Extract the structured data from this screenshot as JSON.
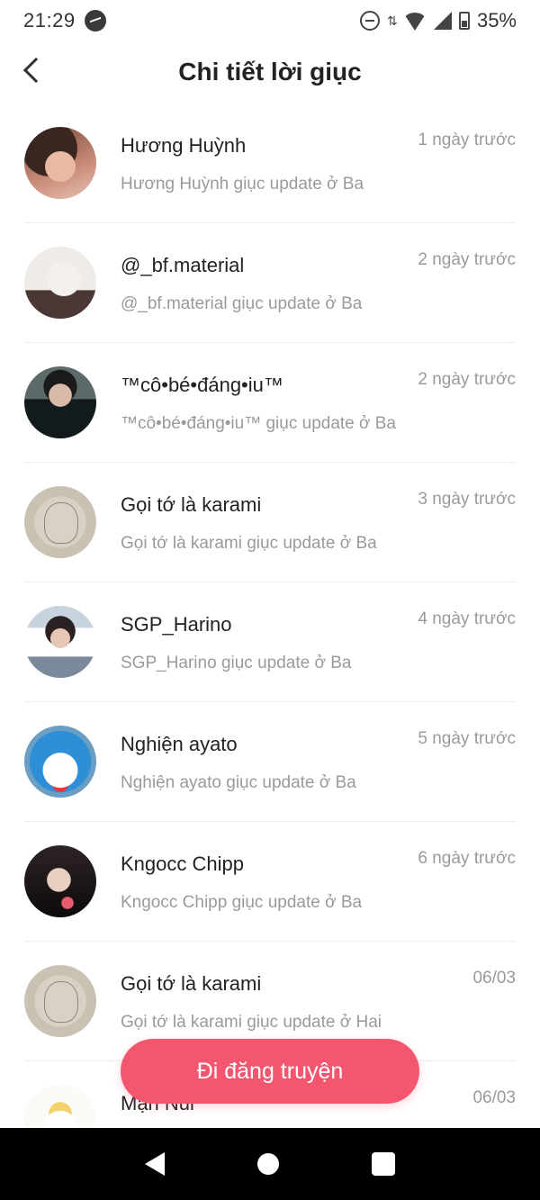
{
  "status_bar": {
    "time": "21:29",
    "battery": "35%",
    "icons": [
      "messenger-icon",
      "dnd-icon",
      "data-icon",
      "wifi-icon",
      "signal-icon",
      "battery-icon"
    ]
  },
  "header": {
    "title": "Chi tiết lời giục",
    "back_icon": "chevron-left-icon"
  },
  "items": [
    {
      "name": "Hương Huỳnh",
      "message": "Hương Huỳnh giục update ở Ba",
      "time": "1 ngày trước"
    },
    {
      "name": "@_bf.material",
      "message": "@_bf.material giục update ở Ba",
      "time": "2 ngày trước"
    },
    {
      "name": "™cô•bé•đáng•iu™",
      "message": "™cô•bé•đáng•iu™ giục update ở Ba",
      "time": "2 ngày trước"
    },
    {
      "name": "Gọi tớ là karami",
      "message": "Gọi tớ là karami giục update ở Ba",
      "time": "3 ngày trước"
    },
    {
      "name": "SGP_Harino",
      "message": "SGP_Harino giục update ở Ba",
      "time": "4 ngày trước"
    },
    {
      "name": "Nghiện ayato",
      "message": "Nghiện ayato giục update ở Ba",
      "time": "5 ngày trước"
    },
    {
      "name": "Kngocc Chipp",
      "message": "Kngocc Chipp giục update ở Ba",
      "time": "6 ngày trước"
    },
    {
      "name": "Gọi tớ là karami",
      "message": "Gọi tớ là karami giục update ở Hai",
      "time": "06/03"
    },
    {
      "name": "Mạn Nui",
      "message": "",
      "time": "06/03"
    }
  ],
  "post_button": {
    "label": "Đi đăng truyện",
    "color": "#f4566f"
  },
  "nav_bar": {
    "icons": [
      "back-triangle-icon",
      "home-circle-icon",
      "recents-square-icon"
    ]
  }
}
